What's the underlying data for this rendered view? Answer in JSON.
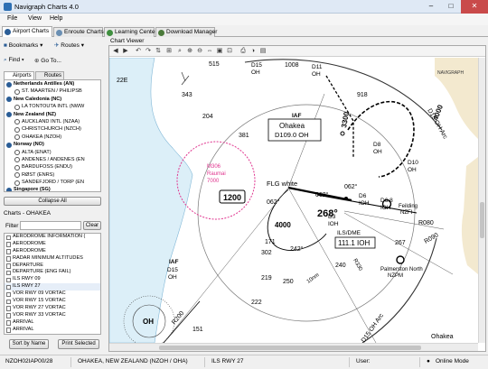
{
  "window": {
    "title": "Navigraph Charts 4.0",
    "minimize": "–",
    "maximize": "□",
    "close": "✕"
  },
  "menu": [
    "File",
    "View",
    "Help"
  ],
  "tabs": [
    {
      "label": "Airport Charts",
      "icon": "airport-icon",
      "color": "#2a5d96"
    },
    {
      "label": "Enroute Charts",
      "icon": "enroute-icon",
      "color": "#6a8fb3"
    },
    {
      "label": "Learning Center",
      "icon": "learning-icon",
      "color": "#3f8f3f"
    },
    {
      "label": "Download Manager",
      "icon": "download-icon",
      "color": "#4a7a3a"
    }
  ],
  "left": {
    "bookmarks": "Bookmarks",
    "routes": "Routes",
    "find": "Find",
    "goto": "Go To...",
    "subtabs": [
      "Airports",
      "Routes"
    ],
    "airports": [
      {
        "type": "country",
        "label": "Netherlands Antilles (AN)"
      },
      {
        "type": "airport",
        "label": "ST. MAARTEN / PHILIPSB"
      },
      {
        "type": "country",
        "label": "New Caledonia (NC)"
      },
      {
        "type": "airport",
        "label": "LA TONTOUTA INTL (NWW"
      },
      {
        "type": "country",
        "label": "New Zealand (NZ)"
      },
      {
        "type": "airport",
        "label": "AUCKLAND INTL (NZAA)"
      },
      {
        "type": "airport",
        "label": "CHRISTCHURCH (NZCH)"
      },
      {
        "type": "airport",
        "label": "OHAKEA (NZOH)"
      },
      {
        "type": "country",
        "label": "Norway (NO)"
      },
      {
        "type": "airport",
        "label": "ALTA (ENAT)"
      },
      {
        "type": "airport",
        "label": "ANDENES / ANDENES (EN"
      },
      {
        "type": "airport",
        "label": "BARDUFOSS (ENDU)"
      },
      {
        "type": "airport",
        "label": "RØST (ENRS)"
      },
      {
        "type": "airport",
        "label": "SANDEFJORD / TORP (EN"
      },
      {
        "type": "country",
        "label": "Singapore (SG)"
      }
    ],
    "collapse_all": "Collapse All",
    "charts_header": "Charts - OHAKEA",
    "filter_label": "Filter",
    "clear": "Clear",
    "charts": [
      "AERODROME INFORMATION (",
      "AERODROME",
      "AERODROME",
      "RADAR MINIMUM ALTITUDES",
      "DEPARTURE",
      "DEPARTURE (ENG FAIL)",
      "ILS RWY 09",
      "ILS RWY 27",
      "VOR RWY 09 VORTAC",
      "VOR RWY 15 VORTAC",
      "VOR RWY 27 VORTAC",
      "VOR RWY 33 VORTAC",
      "ARRIVAL",
      "ARRIVAL"
    ],
    "selected_chart_index": 7,
    "sort_by_name": "Sort by Name",
    "print_selected": "Print Selected"
  },
  "viewer": {
    "label": "Chart Viewer",
    "logo": "NAVIGRAPH",
    "map": {
      "mag_var": "22E",
      "iaf_ohakea": "IAF",
      "ohakea_name": "Ohakea",
      "ohakea_dist": "D109.0 OH",
      "flg_white": "FLG white",
      "m306_1": "M306",
      "m306_2": "Raumai",
      "m306_3": "7000",
      "alt_1200": "1200",
      "alt_4000": "4000",
      "alt_4000b": "4000",
      "alt_3300": "3300",
      "d15_oh_arc": "D15 OH Arc",
      "d15_oh_arc_b": "D15 OH Arc",
      "d15oh_top": "D15",
      "d15oh_top2": "OH",
      "d11oh_1": "D11",
      "d11oh_2": "OH",
      "d8oh_1": "D8",
      "d8oh_2": "OH",
      "d10oh_1": "D10",
      "d10oh_2": "OH",
      "d6ioh_1": "D6",
      "d6ioh_2": "IOH",
      "d68ioh_1": "D6.8",
      "d68ioh_2": "IOH",
      "d3ioh_1": "D3",
      "d3ioh_2": "IOH",
      "feilding_1": "Feilding",
      "feilding_2": "NZFI",
      "ils_dme": "ILS/DME",
      "ioh_freq": "111.1 IOH",
      "palmerston_1": "Palmerston North",
      "palmerston_2": "NZPM",
      "iaf_d15_1": "IAF",
      "iaf_d15_2": "D15",
      "iaf_d15_3": "OH",
      "r200": "R200",
      "r080": "R080",
      "r090": "R090",
      "r330": "R330",
      "crs_268": "268°",
      "crs_062a": "062°",
      "crs_062b": "062°",
      "crs_062c": "062°",
      "crs_242": "242°",
      "crs_171": "171",
      "crs_240": "240",
      "oh_label": "OH",
      "nm_10": "10nm",
      "dist_343": "343",
      "dist_204": "204",
      "dist_381": "381",
      "dist_515": "515",
      "dist_1008": "1008",
      "dist_918": "918",
      "dist_302": "302",
      "dist_219": "219",
      "dist_250": "250",
      "dist_222": "222",
      "dist_267": "267",
      "dist_151": "151",
      "ohakea_tail": "Ohakea"
    }
  },
  "status": {
    "code": "NZOH02IAP00/28",
    "airport": "OHAKEA, NEW ZEALAND (NZOH / OHA)",
    "chart": "ILS RWY 27",
    "user_label": "User:",
    "mode": "Online Mode"
  }
}
